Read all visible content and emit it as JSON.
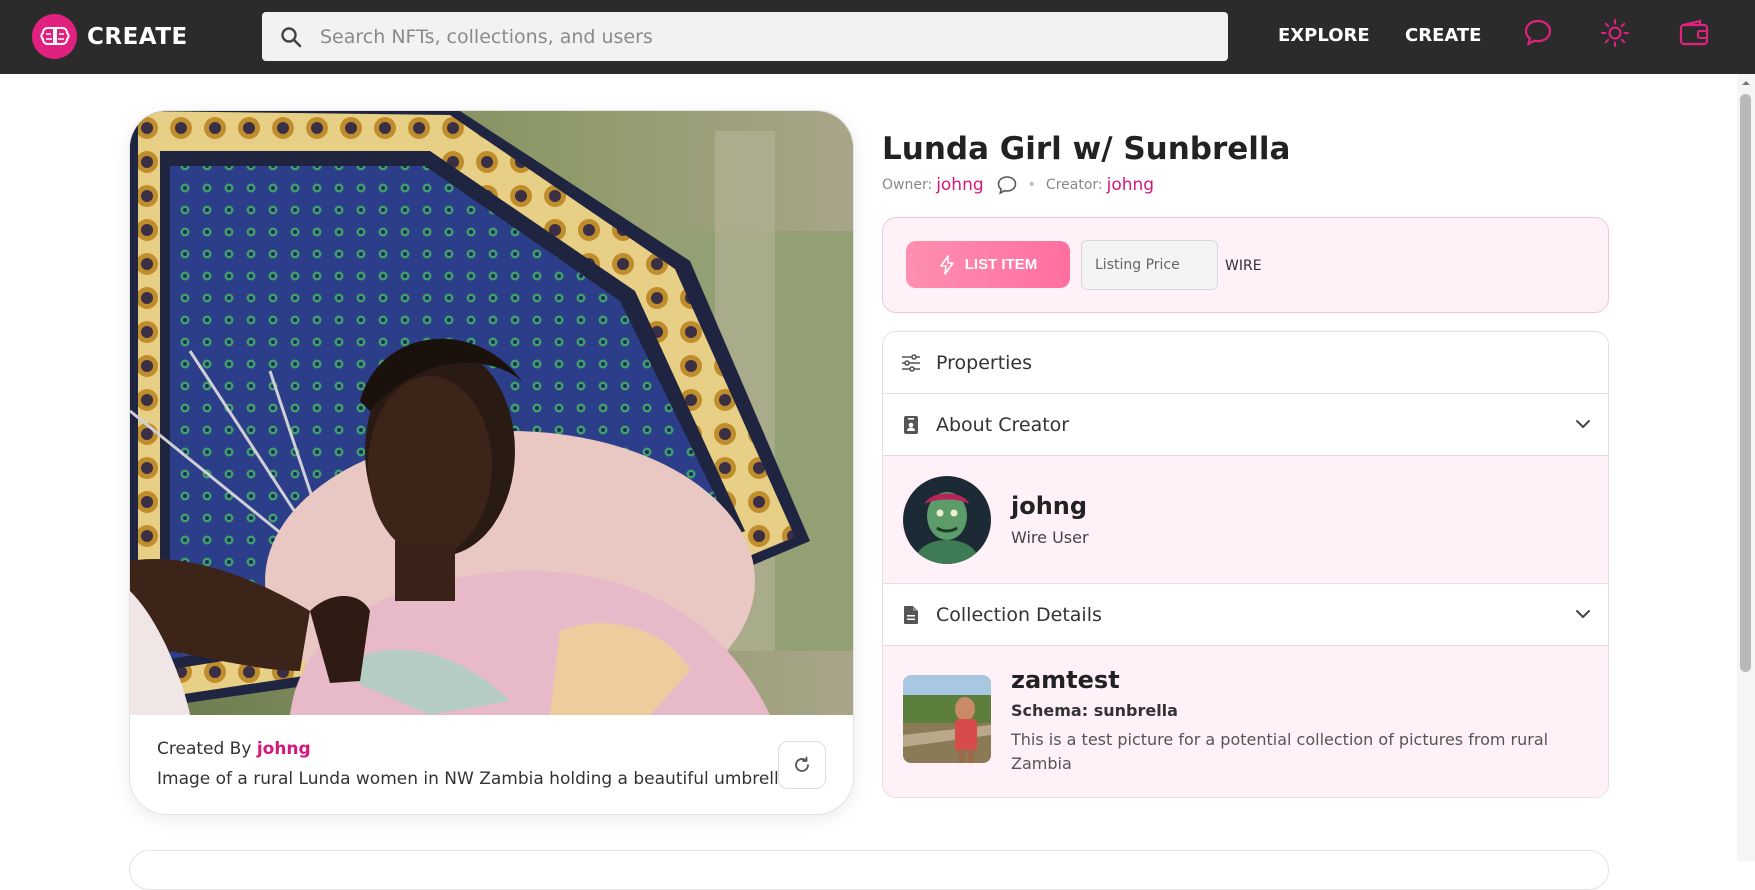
{
  "colors": {
    "brand": "#e0217f",
    "link": "#d6177a",
    "topbar": "#2b2b2b",
    "panel_tint": "#fff1f7"
  },
  "header": {
    "logo_text": "CREATE",
    "search_placeholder": "Search NFTs, collections, and users",
    "nav": {
      "explore": "EXPLORE",
      "create": "CREATE"
    },
    "icons": [
      "chat-icon",
      "sun-icon",
      "wallet-icon"
    ]
  },
  "nft": {
    "title": "Lunda Girl w/ Sunbrella",
    "owner_label": "Owner:",
    "owner": "johng",
    "creator_label": "Creator:",
    "creator": "johng",
    "created_by_label": "Created By",
    "created_by": "johng",
    "description": "Image of a rural Lunda women in NW Zambia holding a beautiful umbrella."
  },
  "listing": {
    "button_label": "LIST ITEM",
    "price_placeholder": "Listing Price",
    "currency": "WIRE"
  },
  "panel": {
    "properties_label": "Properties",
    "about_label": "About Creator",
    "creator_name": "johng",
    "creator_role": "Wire User",
    "collection_label": "Collection Details",
    "collection_name": "zamtest",
    "collection_schema": "Schema: sunbrella",
    "collection_desc": "This is a test picture for a potential collection of pictures from rural Zambia"
  }
}
